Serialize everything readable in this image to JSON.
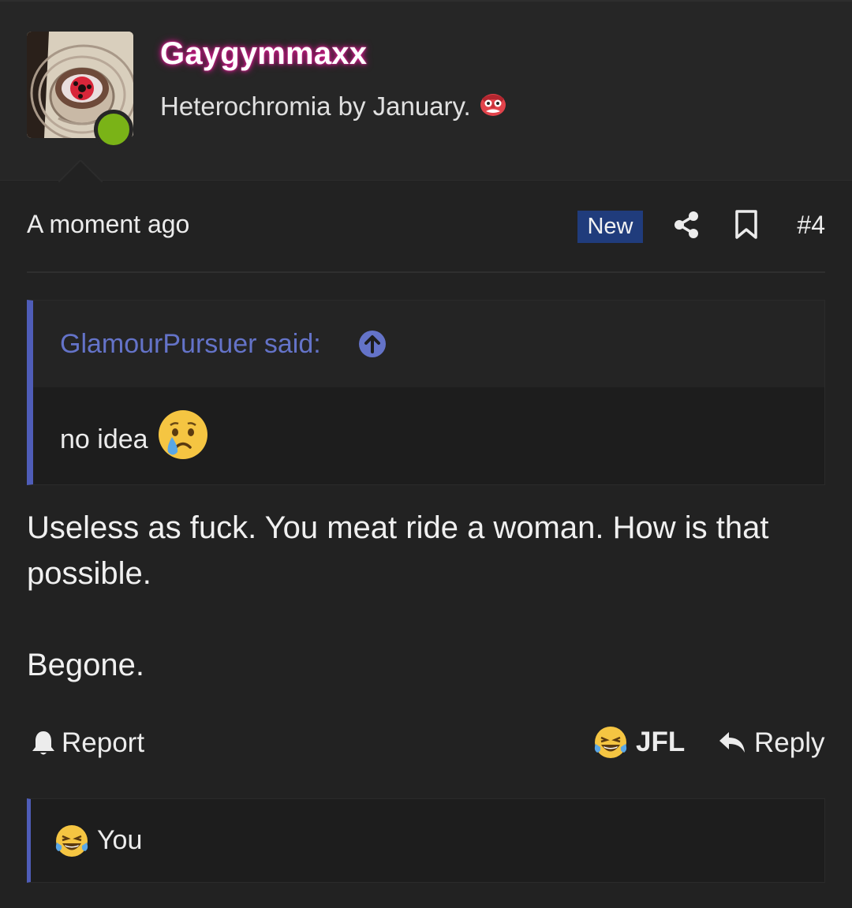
{
  "user": {
    "username": "Gaygymmaxx",
    "title": "Heterochromia by January.",
    "title_emoji": "goblin-mask-icon",
    "online": true,
    "avatar": "sharingan-eye-avatar"
  },
  "post": {
    "time": "A moment ago",
    "badge": "New",
    "number": "#4",
    "quote": {
      "author": "GlamourPursuer said:",
      "text": "no idea",
      "emoji": "crying-face-icon"
    },
    "body": [
      "Useless as fuck. You meat ride a woman. How is that possible.",
      "Begone."
    ]
  },
  "actions": {
    "report": "Report",
    "reaction_label": "JFL",
    "reply": "Reply"
  },
  "reactions": {
    "users": "You",
    "icon": "tears-of-joy-icon"
  },
  "colors": {
    "background": "#222222",
    "accent_quote": "#4f5db8",
    "quote_author": "#6473c8",
    "new_badge": "#203c7c",
    "online": "#7ab317",
    "username_glow": "#d01a8a"
  }
}
